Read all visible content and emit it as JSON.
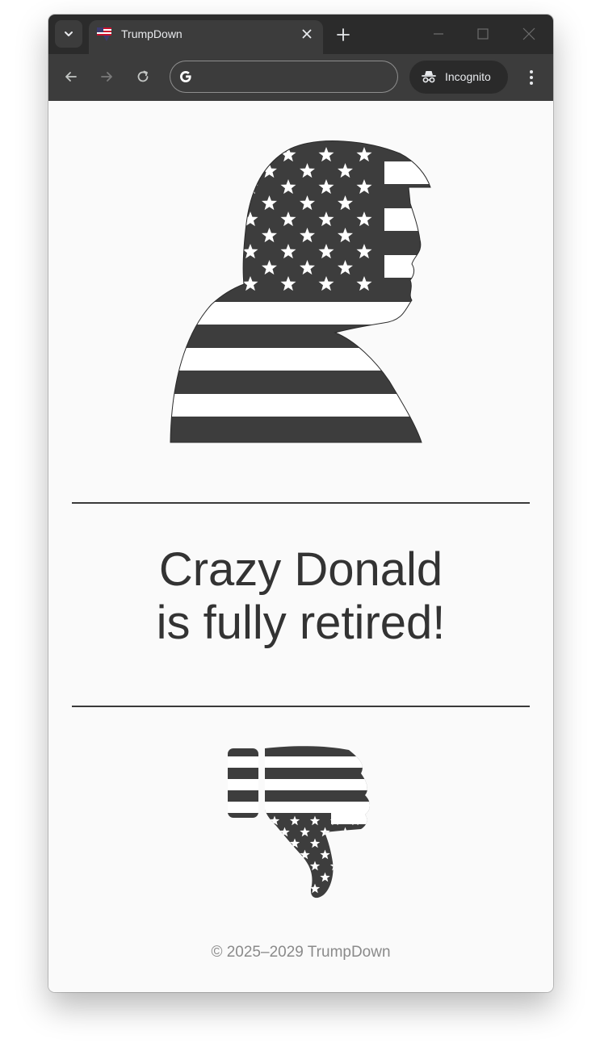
{
  "browser": {
    "tab_title": "TrumpDown",
    "incognito_label": "Incognito",
    "address_value": ""
  },
  "page": {
    "headline_line1": "Crazy Donald",
    "headline_line2": "is fully retired!",
    "footer": "© 2025–2029 TrumpDown"
  },
  "colors": {
    "tabstrip_bg": "#2b2b2b",
    "toolbar_bg": "#3c3c3c",
    "page_bg": "#fafafa",
    "flag_dark": "#3d3d3d",
    "text_dark": "#333333",
    "footer_text": "#8a8a8a"
  },
  "icons": {
    "tab_search": "chevron-down-icon",
    "favicon": "flag-icon",
    "close": "close-icon",
    "new_tab": "plus-icon",
    "back": "arrow-left-icon",
    "forward": "arrow-right-icon",
    "reload": "reload-icon",
    "search_engine": "google-g-icon",
    "incognito": "incognito-icon",
    "menu": "kebab-menu-icon"
  }
}
